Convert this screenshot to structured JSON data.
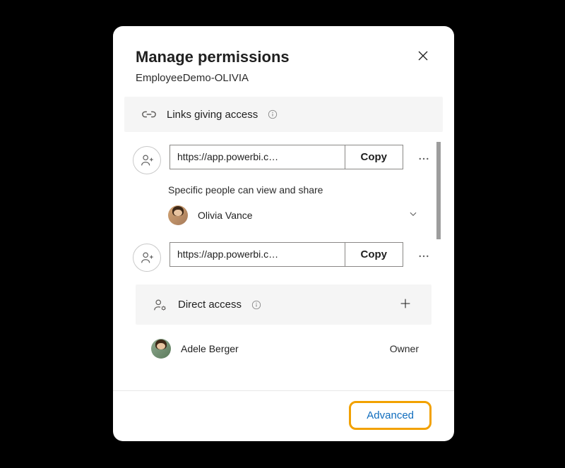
{
  "dialog": {
    "title": "Manage permissions",
    "subtitle": "EmployeeDemo-OLIVIA"
  },
  "linksSection": {
    "title": "Links giving access"
  },
  "links": [
    {
      "url": "https://app.powerbi.c…",
      "copyLabel": "Copy",
      "description": "Specific people can view and share",
      "people": [
        {
          "name": "Olivia Vance"
        }
      ]
    },
    {
      "url": "https://app.powerbi.c…",
      "copyLabel": "Copy"
    }
  ],
  "directSection": {
    "title": "Direct access"
  },
  "directPeople": [
    {
      "name": "Adele Berger",
      "role": "Owner"
    }
  ],
  "footer": {
    "advancedLabel": "Advanced"
  }
}
